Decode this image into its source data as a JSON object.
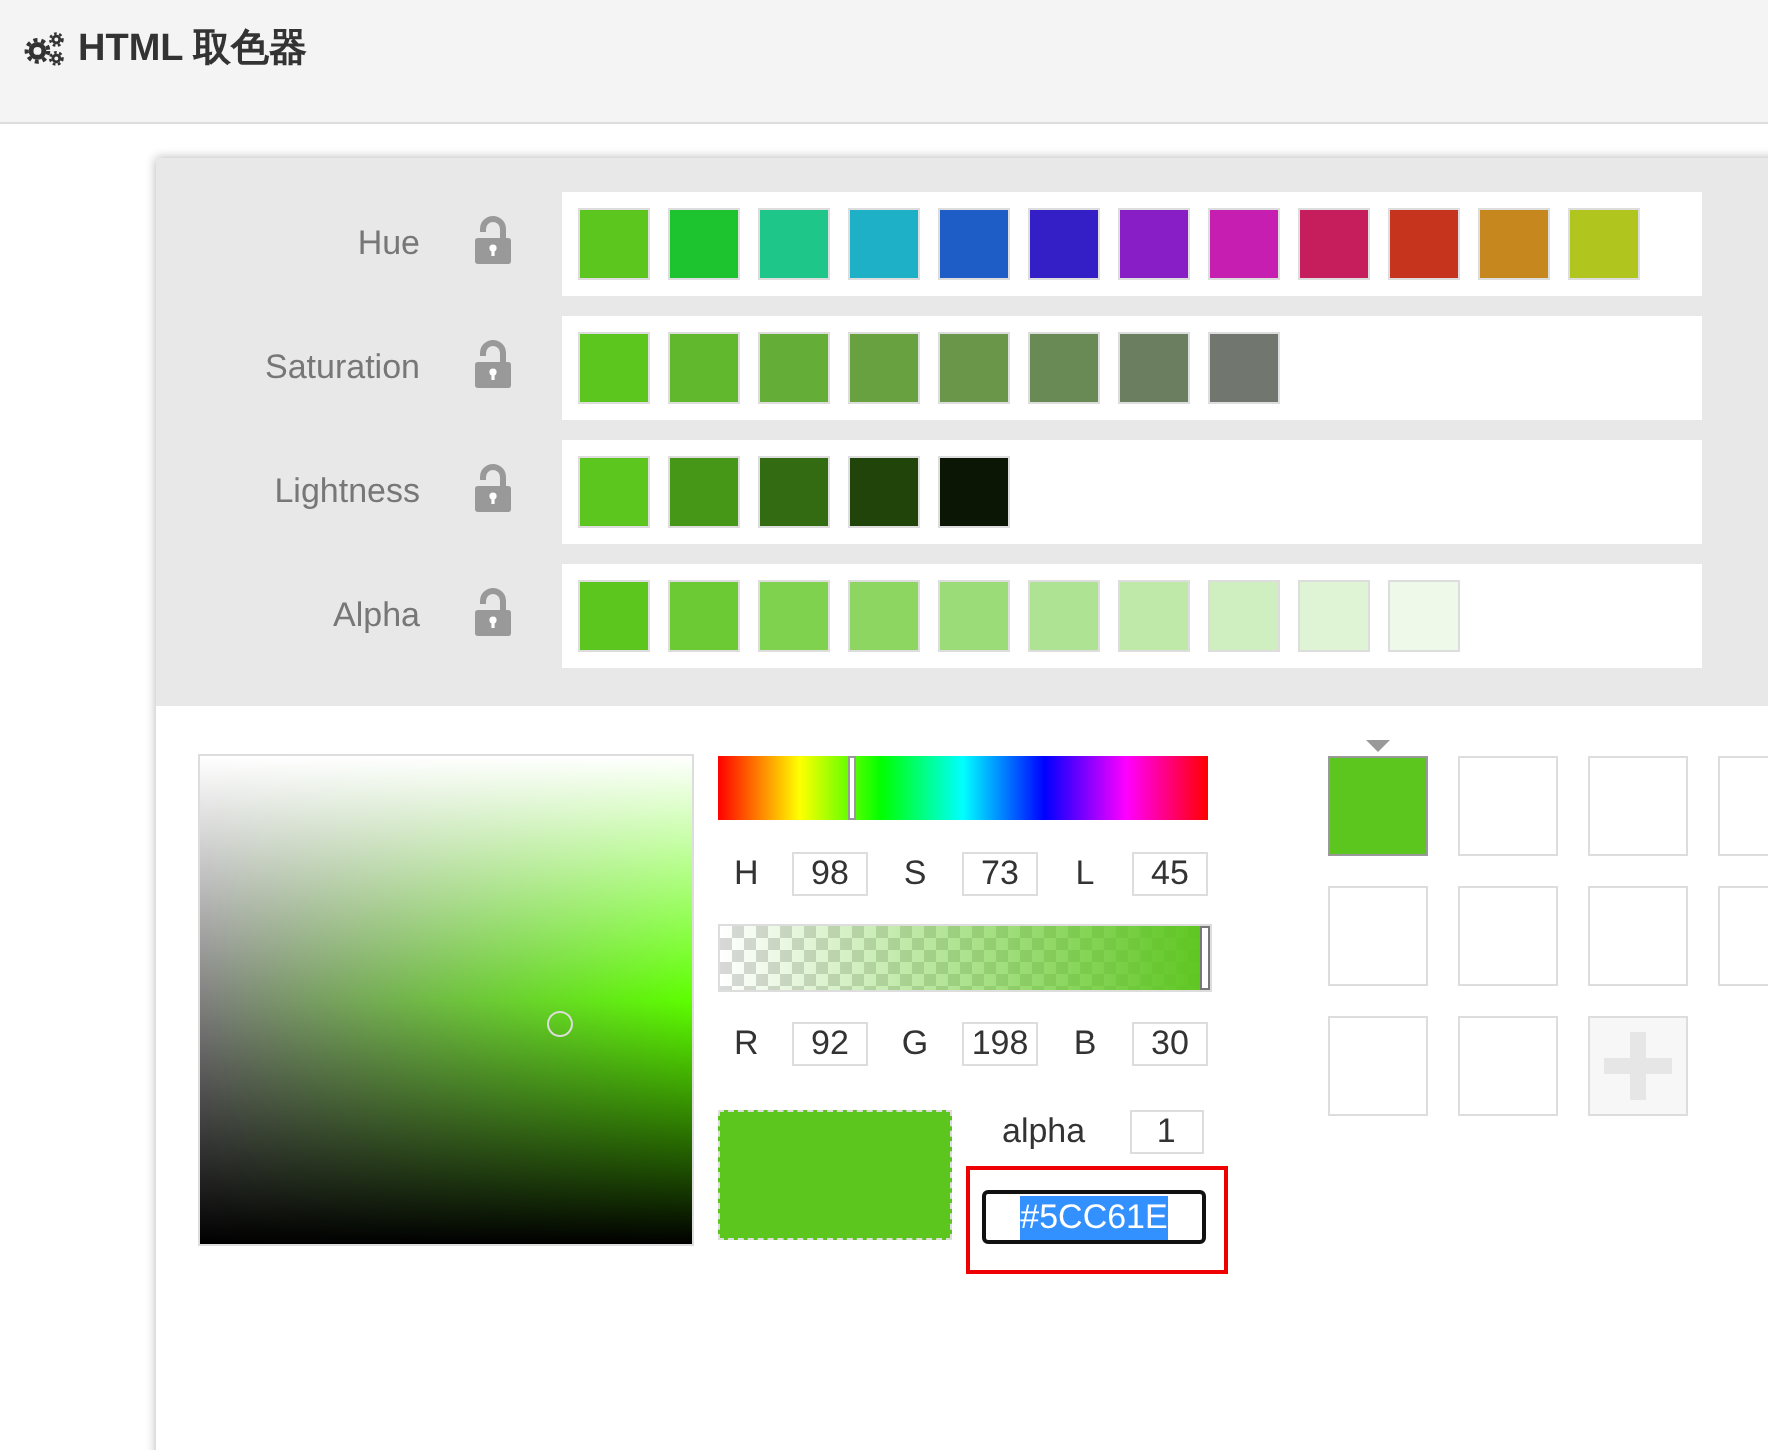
{
  "header": {
    "title": "HTML 取色器"
  },
  "variations": [
    {
      "label": "Hue",
      "locked": false,
      "swatches": [
        {
          "color": "#5cc61e"
        },
        {
          "color": "#1ec42f"
        },
        {
          "color": "#1ec68a"
        },
        {
          "color": "#1eb0c6"
        },
        {
          "color": "#1e5cc6"
        },
        {
          "color": "#341ec6"
        },
        {
          "color": "#881ec6"
        },
        {
          "color": "#c61eb0"
        },
        {
          "color": "#c61e5c"
        },
        {
          "color": "#c6341e"
        },
        {
          "color": "#c6881e"
        },
        {
          "color": "#b0c61e"
        }
      ]
    },
    {
      "label": "Saturation",
      "locked": false,
      "swatches": [
        {
          "color": "#5cc61e"
        },
        {
          "color": "#61b82c"
        },
        {
          "color": "#64ad36"
        },
        {
          "color": "#67a140"
        },
        {
          "color": "#699649"
        },
        {
          "color": "#6a8a55"
        },
        {
          "color": "#6b7f60"
        },
        {
          "color": "#71766f"
        }
      ]
    },
    {
      "label": "Lightness",
      "locked": false,
      "swatches": [
        {
          "color": "#5cc61e"
        },
        {
          "color": "#469618"
        },
        {
          "color": "#336b12"
        },
        {
          "color": "#21440b"
        },
        {
          "color": "#0c1604"
        }
      ]
    },
    {
      "label": "Alpha",
      "locked": false,
      "swatches": [
        {
          "color": "#5cc61e"
        },
        {
          "color": "#6ccb35"
        },
        {
          "color": "#7fd24e"
        },
        {
          "color": "#8cd661"
        },
        {
          "color": "#9bdc78"
        },
        {
          "color": "#aee394"
        },
        {
          "color": "#bfe9a8"
        },
        {
          "color": "#d0efc0"
        },
        {
          "color": "#dff4d5"
        },
        {
          "color": "#eff9e9"
        }
      ]
    }
  ],
  "picker": {
    "sl_area": {
      "saturation": {
        "level": 0.73
      }
    },
    "hue_slider": {
      "level": 0.272
    },
    "hsl_fields": [
      {
        "label": "H",
        "value": "98"
      },
      {
        "label": "S",
        "value": "73"
      },
      {
        "label": "L",
        "value": "45"
      }
    ],
    "alpha_slider": {
      "level": 1
    },
    "rgb_fields": [
      {
        "label": "R",
        "value": "92"
      },
      {
        "label": "G",
        "value": "198"
      },
      {
        "label": "B",
        "value": "30"
      }
    ],
    "preview": {
      "color": "#5cc61e"
    },
    "alpha_field": {
      "label": "alpha",
      "value": "1"
    },
    "hex_field": {
      "value": "#5CC61E",
      "focused": true,
      "text_selected": true,
      "highlighted": true
    }
  },
  "palette": [
    {
      "kind": "color",
      "color": "#5cc61e",
      "selected": true
    },
    {
      "kind": "empty",
      "selected": false
    },
    {
      "kind": "empty",
      "selected": false
    },
    {
      "kind": "empty",
      "selected": false
    },
    {
      "kind": "empty",
      "selected": false
    },
    {
      "kind": "empty",
      "selected": false
    },
    {
      "kind": "empty",
      "selected": false
    },
    {
      "kind": "empty",
      "selected": false
    },
    {
      "kind": "empty",
      "selected": false
    },
    {
      "kind": "empty",
      "selected": false
    },
    {
      "kind": "add",
      "selected": false
    }
  ]
}
